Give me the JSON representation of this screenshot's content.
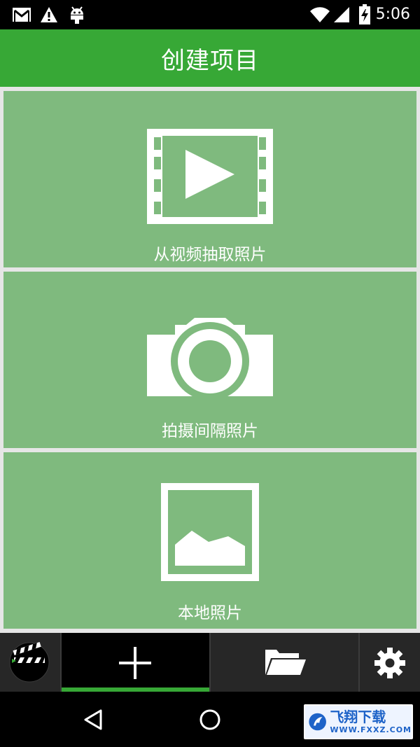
{
  "status_bar": {
    "time": "5:06",
    "icons": [
      "gmail-icon",
      "warning-icon",
      "android-icon",
      "wifi-icon",
      "signal-icon",
      "battery-charging-icon"
    ]
  },
  "app_bar": {
    "title": "创建项目"
  },
  "cards": [
    {
      "label": "从视频抽取照片",
      "icon": "video-film-icon"
    },
    {
      "label": "拍摄间隔照片",
      "icon": "camera-icon"
    },
    {
      "label": "本地照片",
      "icon": "image-icon"
    }
  ],
  "bottom_nav": {
    "items": [
      "clapperboard-logo-icon",
      "add-icon",
      "folder-icon",
      "gear-icon"
    ],
    "active": "add-icon"
  },
  "system_nav": {
    "items": [
      "back-icon",
      "home-icon"
    ]
  },
  "watermark": {
    "cn": "飞翔下载",
    "en": "WWW.FXXZ.COM"
  },
  "colors": {
    "accent": "#37a836",
    "card": "#7fba7e",
    "nav_bg": "#272727"
  }
}
